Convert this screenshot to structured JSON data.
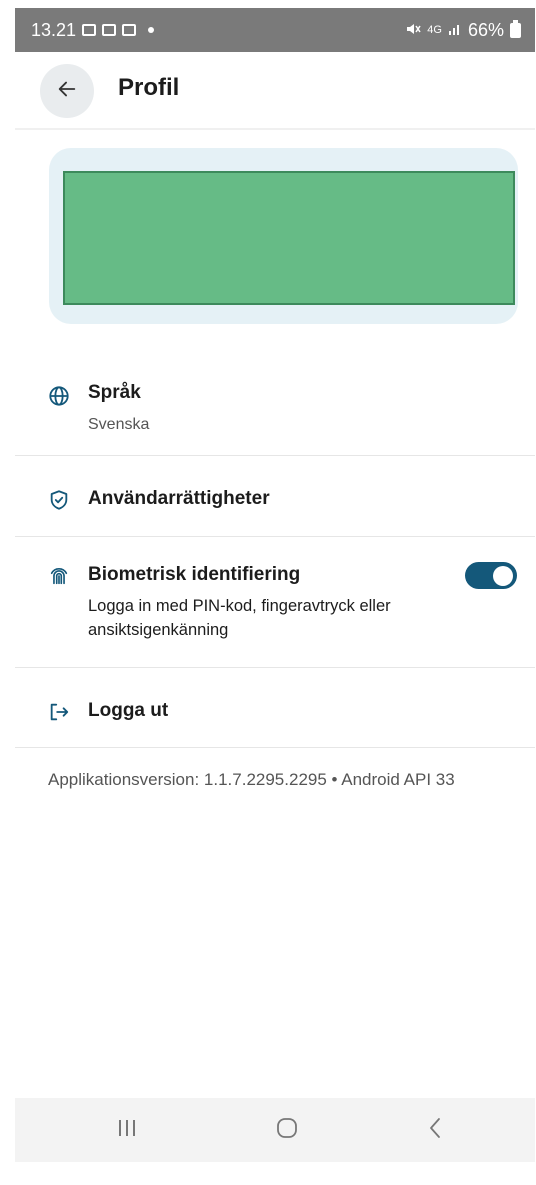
{
  "status_bar": {
    "time": "13.21",
    "network": "4G",
    "battery": "66%"
  },
  "header": {
    "title": "Profil",
    "back_icon": "arrow-left-icon"
  },
  "profile_card": {
    "accent": "#66bb86",
    "background": "#e5f1f6"
  },
  "settings": {
    "language": {
      "title": "Språk",
      "value": "Svenska",
      "icon": "globe-icon"
    },
    "permissions": {
      "title": "Användarrättigheter",
      "icon": "shield-check-icon"
    },
    "biometric": {
      "title": "Biometrisk identifiering",
      "description": "Logga in med PIN-kod, fingeravtryck eller ansiktsigenkänning",
      "enabled": true,
      "icon": "fingerprint-icon"
    },
    "logout": {
      "title": "Logga ut",
      "icon": "logout-icon"
    }
  },
  "footer": {
    "version_text": "Applikationsversion: 1.1.7.2295.2295 • Android API 33"
  },
  "colors": {
    "toggle_on": "#14587a",
    "icon": "#14587a"
  }
}
